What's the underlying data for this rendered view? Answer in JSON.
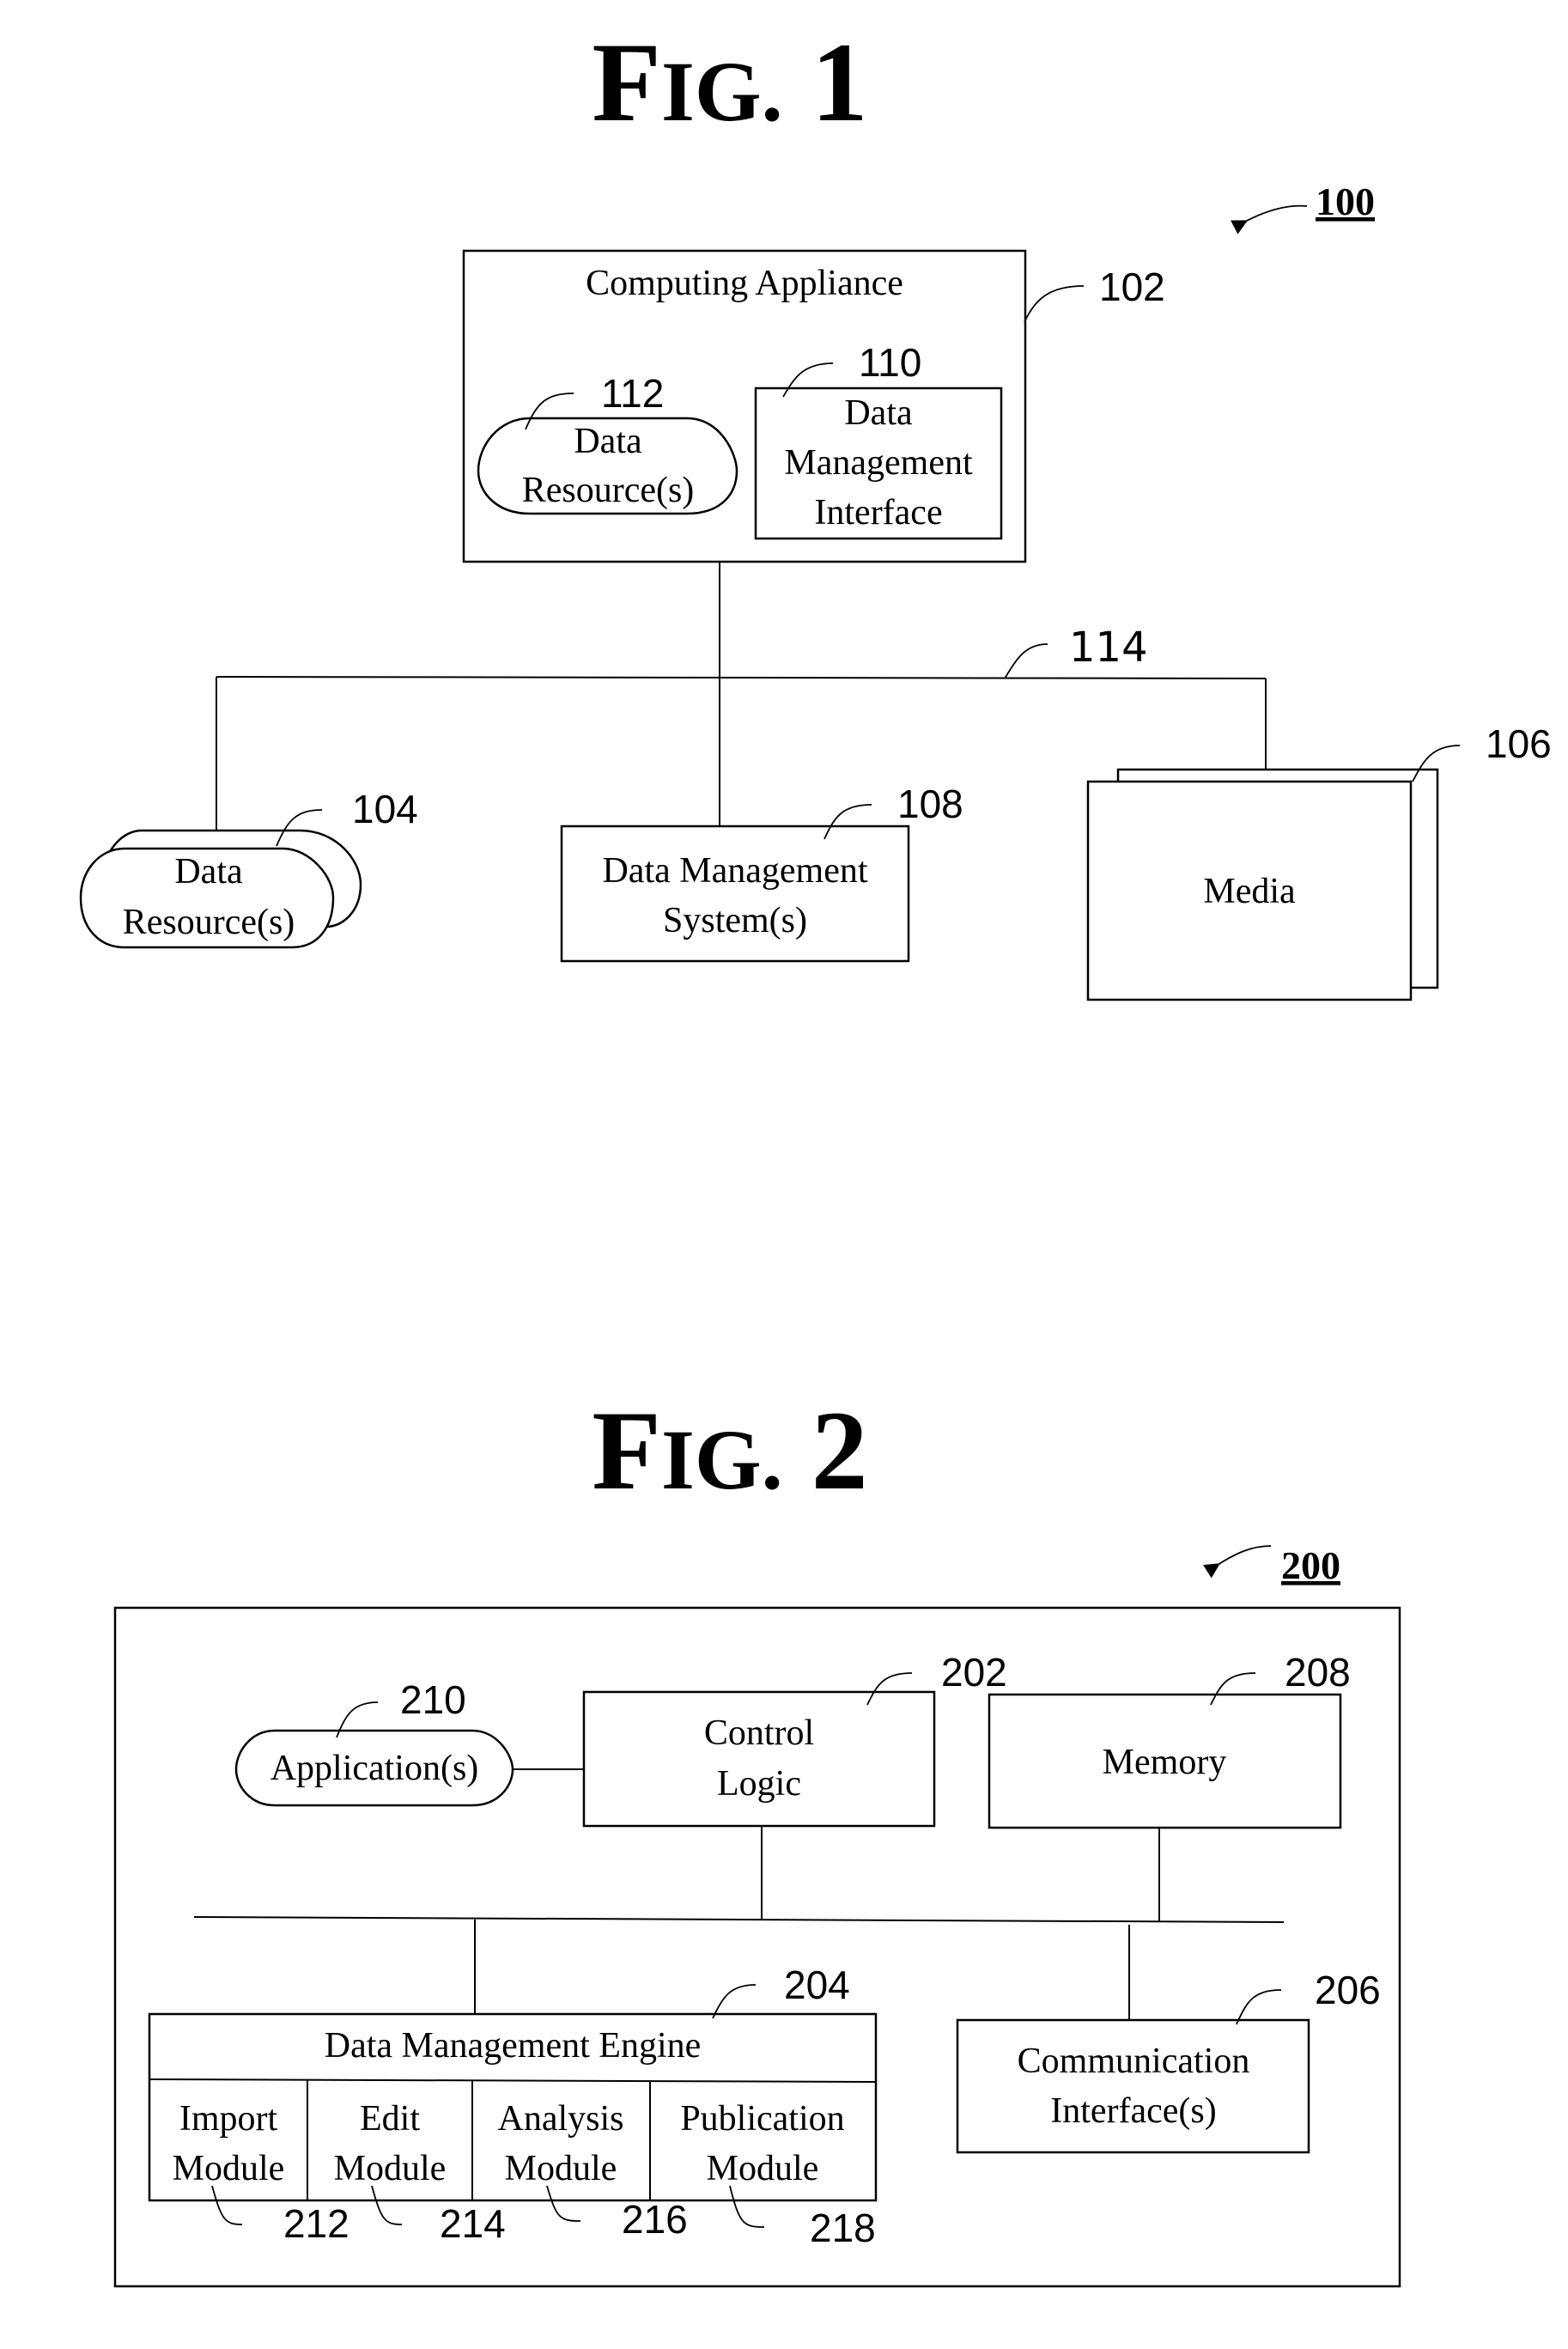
{
  "fig1": {
    "title_prefix": "F",
    "title_smallcaps": "IG.",
    "title_number": "1",
    "figure_ref": "100",
    "computing_appliance": {
      "label": "Computing Appliance",
      "ref": "102"
    },
    "internal_data_resources": {
      "line1": "Data",
      "line2": "Resource(s)",
      "ref": "112"
    },
    "data_management_interface": {
      "line1": "Data",
      "line2": "Management",
      "line3": "Interface",
      "ref": "110"
    },
    "network": {
      "ref": "114"
    },
    "external_data_resources": {
      "line1": "Data",
      "line2": "Resource(s)",
      "ref": "104"
    },
    "data_management_systems": {
      "line1": "Data Management",
      "line2": "System(s)",
      "ref": "108"
    },
    "media": {
      "label": "Media",
      "ref": "106"
    }
  },
  "fig2": {
    "title_prefix": "F",
    "title_smallcaps": "IG.",
    "title_number": "2",
    "figure_ref": "200",
    "applications": {
      "label": "Application(s)",
      "ref": "210"
    },
    "control_logic": {
      "line1": "Control",
      "line2": "Logic",
      "ref": "202"
    },
    "memory": {
      "label": "Memory",
      "ref": "208"
    },
    "data_management_engine": {
      "label": "Data Management Engine",
      "ref": "204",
      "modules": [
        {
          "line1": "Import",
          "line2": "Module",
          "ref": "212"
        },
        {
          "line1": "Edit",
          "line2": "Module",
          "ref": "214"
        },
        {
          "line1": "Analysis",
          "line2": "Module",
          "ref": "216"
        },
        {
          "line1": "Publication",
          "line2": "Module",
          "ref": "218"
        }
      ]
    },
    "communication_interfaces": {
      "line1": "Communication",
      "line2": "Interface(s)",
      "ref": "206"
    }
  }
}
